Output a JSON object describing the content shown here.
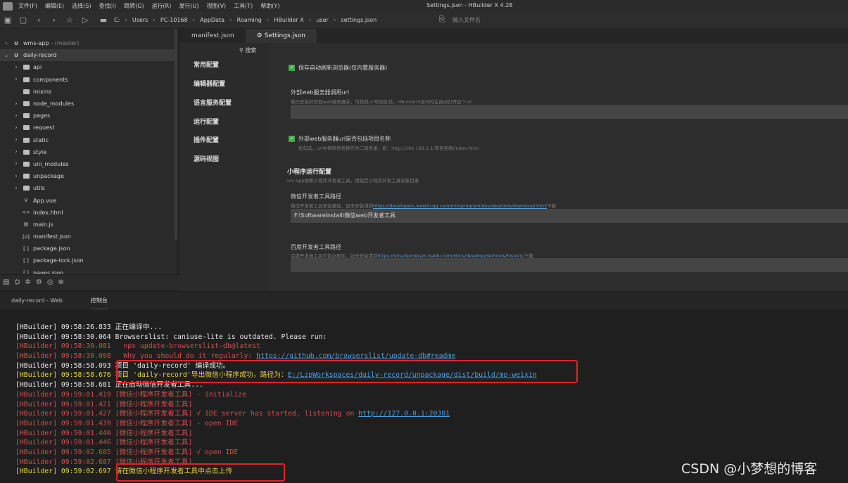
{
  "window": {
    "title": "Settings.json - HBuilder X 4.28",
    "menu": [
      "文件(F)",
      "编辑(E)",
      "选择(S)",
      "查找(I)",
      "跳转(G)",
      "运行(R)",
      "发行(U)",
      "视图(V)",
      "工具(T)",
      "帮助(Y)"
    ]
  },
  "toolbar": {
    "breadcrumb": [
      "C:",
      "Users",
      "PC-10168",
      "AppData",
      "Roaming",
      "HBuilder X",
      "user",
      "settings.json"
    ],
    "file_search_placeholder": "输入文件名"
  },
  "sidebar": {
    "projects": [
      {
        "name": "wms-app",
        "branch": "- (master)",
        "expanded": false
      },
      {
        "name": "daily-record",
        "expanded": true,
        "selected": true
      }
    ],
    "items": [
      {
        "name": "api",
        "type": "folder",
        "chevron": true
      },
      {
        "name": "components",
        "type": "folder",
        "chevron": true
      },
      {
        "name": "mixins",
        "type": "folder",
        "chevron": false
      },
      {
        "name": "node_modules",
        "type": "folder",
        "chevron": true
      },
      {
        "name": "pages",
        "type": "folder",
        "chevron": true
      },
      {
        "name": "request",
        "type": "folder",
        "chevron": true
      },
      {
        "name": "static",
        "type": "folder",
        "chevron": true
      },
      {
        "name": "style",
        "type": "folder",
        "chevron": true
      },
      {
        "name": "uni_modules",
        "type": "folder",
        "chevron": true
      },
      {
        "name": "unpackage",
        "type": "folder",
        "chevron": true
      },
      {
        "name": "utils",
        "type": "folder",
        "chevron": true
      },
      {
        "name": "App.vue",
        "type": "file",
        "icon": "V"
      },
      {
        "name": "index.html",
        "type": "file",
        "icon": "<>"
      },
      {
        "name": "main.js",
        "type": "file",
        "icon": "▤"
      },
      {
        "name": "manifest.json",
        "type": "file",
        "icon": "[o]"
      },
      {
        "name": "package.json",
        "type": "file",
        "icon": "[ ]"
      },
      {
        "name": "package-lock.json",
        "type": "file",
        "icon": "[ ]"
      },
      {
        "name": "pages.json",
        "type": "file",
        "icon": "[ ]"
      }
    ]
  },
  "editor": {
    "tabs": [
      {
        "label": "manifest.json",
        "active": false
      },
      {
        "label": "Settings.json",
        "active": true,
        "icon": "⚙"
      }
    ]
  },
  "settings": {
    "search_label": "搜索",
    "nav": [
      "常用配置",
      "编辑器配置",
      "语言服务配置",
      "运行配置",
      "插件配置",
      "源码视图"
    ],
    "checkbox_auto_refresh": "保存自动刷新浏览器(仅内置服务器)",
    "external_url_title": "外部web服务器调用url",
    "external_url_desc": "若已安装好其他web服务器并，可将其url填到此处。HBuilderX运行时会自动打开这个url",
    "checkbox_include_project": "外部web服务器url是否包括项目名称",
    "include_project_desc": "如勾选，url中将项目名称作为二级目录。如：http://192.168.1.1/项目名称/index.html",
    "mini_section_title": "小程序运行配置",
    "mini_section_desc": "uni-app依赖小程序开发者工具，请指定小程序开发工具安装目录",
    "wechat_title": "微信开发者工具路径",
    "wechat_desc_prefix": "微信开发者工具安装路径，如未安装请到",
    "wechat_link": "https://developers.weixin.qq.com/miniprogram/dev/devtools/download.html",
    "wechat_desc_suffix": "下载",
    "wechat_value": "F:\\SoftwareInstall\\微信web开发者工具",
    "baidu_title": "百度开发者工具路径",
    "baidu_desc_prefix": "百度开发者工具可协办程序，如未安装请到",
    "baidu_link": "https://smartprogram.baidu.com/docs/develop/devtools/history/",
    "baidu_desc_suffix": "下载",
    "baidu_value": ""
  },
  "panel": {
    "tabs": [
      {
        "label": "daily-record - Web",
        "active": false
      },
      {
        "label": "控制台",
        "active": true
      }
    ]
  },
  "console": [
    {
      "tag": "[HBuilder]",
      "time": "09:58:26.833",
      "msg": "正在编译中...",
      "color": "white"
    },
    {
      "tag": "[HBuilder]",
      "time": "09:58:30.064",
      "msg": "Browserslist: caniuse-lite is outdated. Please run:",
      "color": "white"
    },
    {
      "tag": "[HBuilder]",
      "time": "09:58:30.081",
      "msg": "  npx update-browserslist-db@latest",
      "color": "red"
    },
    {
      "tag": "[HBuilder]",
      "time": "09:58:30.098",
      "msg": "  Why you should do it regularly: ",
      "link": "https://github.com/browserslist/update-db#readme",
      "color": "red"
    },
    {
      "tag": "[HBuilder]",
      "time": "09:58:58.093",
      "msg": "项目 'daily-record' 编译成功。",
      "color": "white"
    },
    {
      "tag": "[HBuilder]",
      "time": "09:58:58.676",
      "msg": "项目 'daily-record'导出微信小程序成功，路径为：",
      "link": "E:/LzpWorkspaces/daily-record/unpackage/dist/build/mp-weixin",
      "color": "yellow"
    },
    {
      "tag": "[HBuilder]",
      "time": "09:58:58.681",
      "msg": "正在启动微信开发者工具...",
      "color": "white"
    },
    {
      "tag": "[HBuilder]",
      "time": "09:59:01.419",
      "msg": "[微信小程序开发者工具] - initialize",
      "color": "red"
    },
    {
      "tag": "[HBuilder]",
      "time": "09:59:01.421",
      "msg": "[微信小程序开发者工具]",
      "color": "red"
    },
    {
      "tag": "[HBuilder]",
      "time": "09:59:01.427",
      "msg": "[微信小程序开发者工具] √ IDE server has started, listening on ",
      "link": "http://127.0.0.1:20301",
      "color": "red"
    },
    {
      "tag": "[HBuilder]",
      "time": "09:59:01.439",
      "msg": "[微信小程序开发者工具] - open IDE",
      "color": "red"
    },
    {
      "tag": "[HBuilder]",
      "time": "09:59:01.440",
      "msg": "[微信小程序开发者工具]",
      "color": "red"
    },
    {
      "tag": "[HBuilder]",
      "time": "09:59:01.446",
      "msg": "[微信小程序开发者工具]",
      "color": "red"
    },
    {
      "tag": "[HBuilder]",
      "time": "09:59:02.685",
      "msg": "[微信小程序开发者工具] √ open IDE",
      "color": "red"
    },
    {
      "tag": "[HBuilder]",
      "time": "09:59:02.687",
      "msg": "[微信小程序开发者工具]",
      "color": "red"
    },
    {
      "tag": "[HBuilder]",
      "time": "09:59:02.697",
      "msg": "请在微信小程序开发者工具中点击上传",
      "color": "yellow"
    }
  ],
  "watermark": "CSDN @小梦想的博客",
  "colors": {
    "error": "#d0504c",
    "highlight": "#e7d53c",
    "link": "#4a9fe0",
    "annotation": "#e0222a"
  }
}
